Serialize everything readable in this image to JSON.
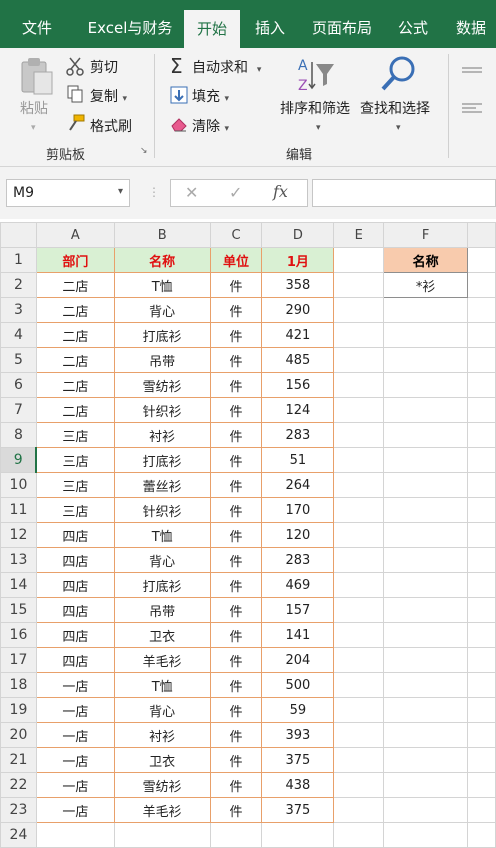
{
  "tabs": [
    "文件",
    "Excel与财务",
    "开始",
    "插入",
    "页面布局",
    "公式",
    "数据"
  ],
  "active_tab": "开始",
  "ribbon": {
    "clipboard": {
      "paste": "粘贴",
      "cut": "剪切",
      "copy": "复制",
      "format_painter": "格式刷",
      "group_label": "剪贴板"
    },
    "editing": {
      "autosum": "自动求和",
      "fill": "填充",
      "clear": "清除",
      "sort_filter": "排序和筛选",
      "find_select": "查找和选择",
      "group_label": "编辑"
    }
  },
  "formula_bar": {
    "name_box": "M9",
    "fx": "fx",
    "formula": ""
  },
  "sheet": {
    "col_headers": [
      "A",
      "B",
      "C",
      "D",
      "E",
      "F"
    ],
    "header_row": [
      "部门",
      "名称",
      "单位",
      "1月"
    ],
    "criteria": {
      "header": "名称",
      "value": "*衫"
    },
    "rows": [
      [
        "二店",
        "T恤",
        "件",
        "358"
      ],
      [
        "二店",
        "背心",
        "件",
        "290"
      ],
      [
        "二店",
        "打底衫",
        "件",
        "421"
      ],
      [
        "二店",
        "吊带",
        "件",
        "485"
      ],
      [
        "二店",
        "雪纺衫",
        "件",
        "156"
      ],
      [
        "二店",
        "针织衫",
        "件",
        "124"
      ],
      [
        "三店",
        "衬衫",
        "件",
        "283"
      ],
      [
        "三店",
        "打底衫",
        "件",
        "51"
      ],
      [
        "三店",
        "蕾丝衫",
        "件",
        "264"
      ],
      [
        "三店",
        "针织衫",
        "件",
        "170"
      ],
      [
        "四店",
        "T恤",
        "件",
        "120"
      ],
      [
        "四店",
        "背心",
        "件",
        "283"
      ],
      [
        "四店",
        "打底衫",
        "件",
        "469"
      ],
      [
        "四店",
        "吊带",
        "件",
        "157"
      ],
      [
        "四店",
        "卫衣",
        "件",
        "141"
      ],
      [
        "四店",
        "羊毛衫",
        "件",
        "204"
      ],
      [
        "一店",
        "T恤",
        "件",
        "500"
      ],
      [
        "一店",
        "背心",
        "件",
        "59"
      ],
      [
        "一店",
        "衬衫",
        "件",
        "393"
      ],
      [
        "一店",
        "卫衣",
        "件",
        "375"
      ],
      [
        "一店",
        "雪纺衫",
        "件",
        "438"
      ],
      [
        "一店",
        "羊毛衫",
        "件",
        "375"
      ]
    ],
    "row_numbers": [
      "1",
      "2",
      "3",
      "4",
      "5",
      "6",
      "7",
      "8",
      "9",
      "10",
      "11",
      "12",
      "13",
      "14",
      "15",
      "16",
      "17",
      "18",
      "19",
      "20",
      "21",
      "22",
      "23",
      "24"
    ],
    "selected_row": "9"
  },
  "colors": {
    "accent": "#217346",
    "header_fill": "#d9f0d3",
    "header_text": "#e01010",
    "criteria_fill": "#f8cbad",
    "table_border": "#e8a06a"
  }
}
